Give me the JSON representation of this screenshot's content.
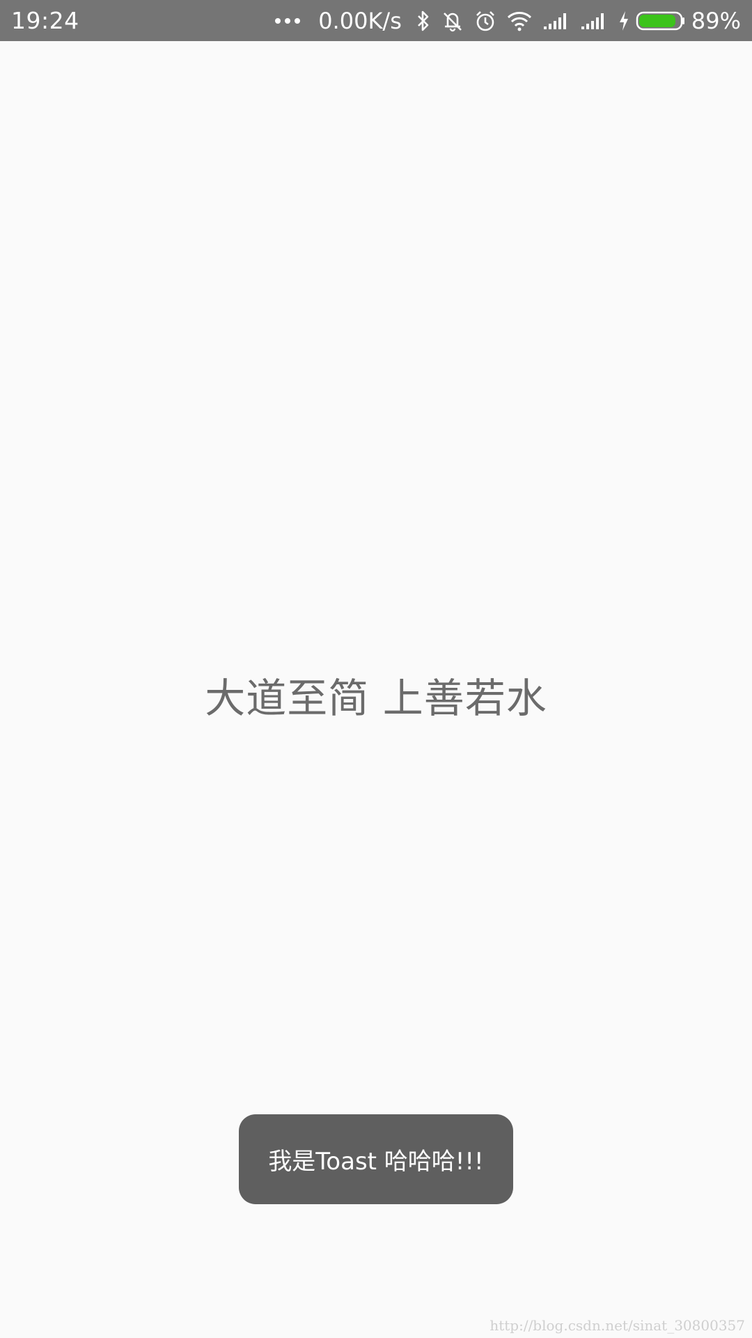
{
  "status_bar": {
    "time": "19:24",
    "network_speed": "0.00K/s",
    "battery_percent": "89%",
    "battery_level": 0.89,
    "battery_color": "#3cc31b",
    "icons": [
      "more-dots-icon",
      "bluetooth-icon",
      "vibrate-off-icon",
      "alarm-icon",
      "wifi-icon",
      "signal-icon",
      "signal-icon",
      "charging-icon",
      "battery-icon"
    ]
  },
  "main": {
    "center_text": "大道至简 上善若水"
  },
  "toast": {
    "message": "我是Toast 哈哈哈!!!"
  },
  "watermark": "http://blog.csdn.net/sinat_30800357"
}
